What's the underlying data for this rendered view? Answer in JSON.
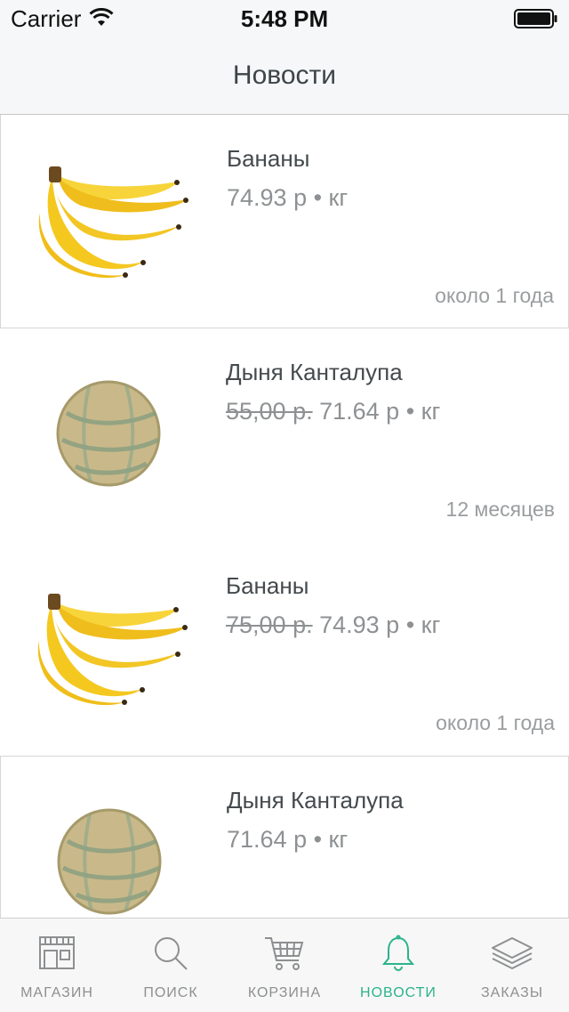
{
  "status_bar": {
    "carrier": "Carrier",
    "time": "5:48 PM"
  },
  "nav": {
    "title": "Новости"
  },
  "items": [
    {
      "name": "Бананы",
      "old_price": "",
      "price": "74.93 р • кг",
      "time": "около 1 года",
      "image": "banana"
    },
    {
      "name": "Дыня Канталупа",
      "old_price": "55,00 р.",
      "price": "71.64 р • кг",
      "time": "12 месяцев",
      "image": "melon"
    },
    {
      "name": "Бананы",
      "old_price": "75,00 р.",
      "price": "74.93 р • кг",
      "time": "около 1 года",
      "image": "banana"
    },
    {
      "name": "Дыня Канталупа",
      "old_price": "",
      "price": "71.64 р • кг",
      "time": "",
      "image": "melon"
    }
  ],
  "tabs": [
    {
      "label": "МАГАЗИН",
      "icon": "store-icon",
      "active": false
    },
    {
      "label": "ПОИСК",
      "icon": "search-icon",
      "active": false
    },
    {
      "label": "КОРЗИНА",
      "icon": "cart-icon",
      "active": false
    },
    {
      "label": "НОВОСТИ",
      "icon": "bell-icon",
      "active": true
    },
    {
      "label": "ЗАКАЗЫ",
      "icon": "layers-icon",
      "active": false
    }
  ],
  "colors": {
    "accent": "#2bb38b",
    "inactive": "#8d8f91",
    "bar_bg": "#f5f7f8"
  }
}
